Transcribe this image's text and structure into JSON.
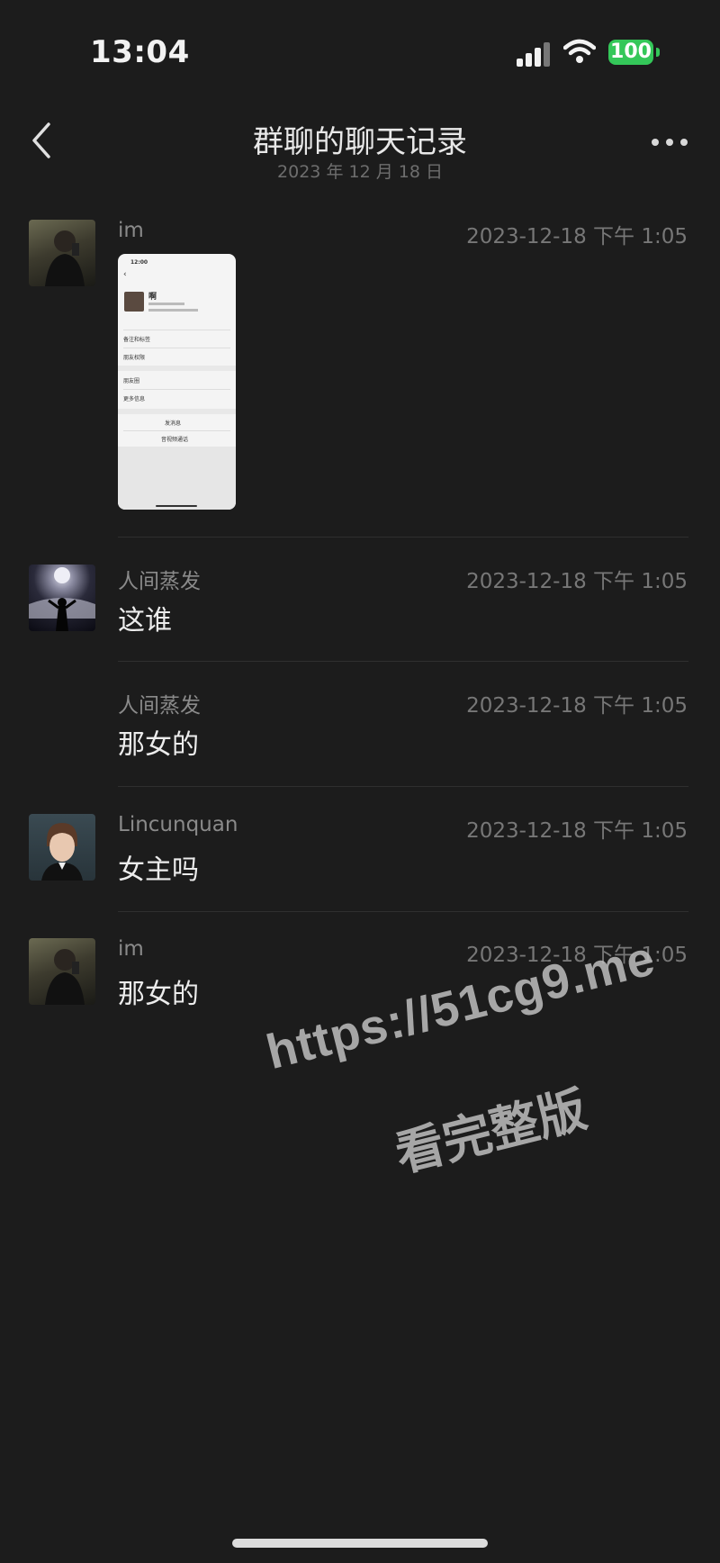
{
  "status_bar": {
    "time": "13:04",
    "battery": "100"
  },
  "header": {
    "title": "群聊的聊天记录",
    "subtitle": "2023 年 12 月 18 日"
  },
  "messages": [
    {
      "sender": "im",
      "time": "2023-12-18 下午 1:05",
      "type": "image",
      "text": ""
    },
    {
      "sender": "人间蒸发",
      "time": "2023-12-18 下午 1:05",
      "type": "text",
      "text": "这谁"
    },
    {
      "sender": "人间蒸发",
      "time": "2023-12-18 下午 1:05",
      "type": "text",
      "text": "那女的"
    },
    {
      "sender": "Lincunquan",
      "time": "2023-12-18 下午 1:05",
      "type": "text",
      "text": "女主吗"
    },
    {
      "sender": "im",
      "time": "2023-12-18 下午 1:05",
      "type": "text",
      "text": "那女的"
    }
  ],
  "thumbnail": {
    "time": "12:00",
    "name": "啊",
    "rows": [
      "备注和标签",
      "朋友权限",
      "朋友圈",
      "更多信息"
    ],
    "actions": [
      "发消息",
      "音视频通话"
    ]
  },
  "watermark": {
    "line1": "https://51cg9.me",
    "line2": "看完整版"
  },
  "colors": {
    "background": "#1c1c1c",
    "battery": "#34c759"
  }
}
